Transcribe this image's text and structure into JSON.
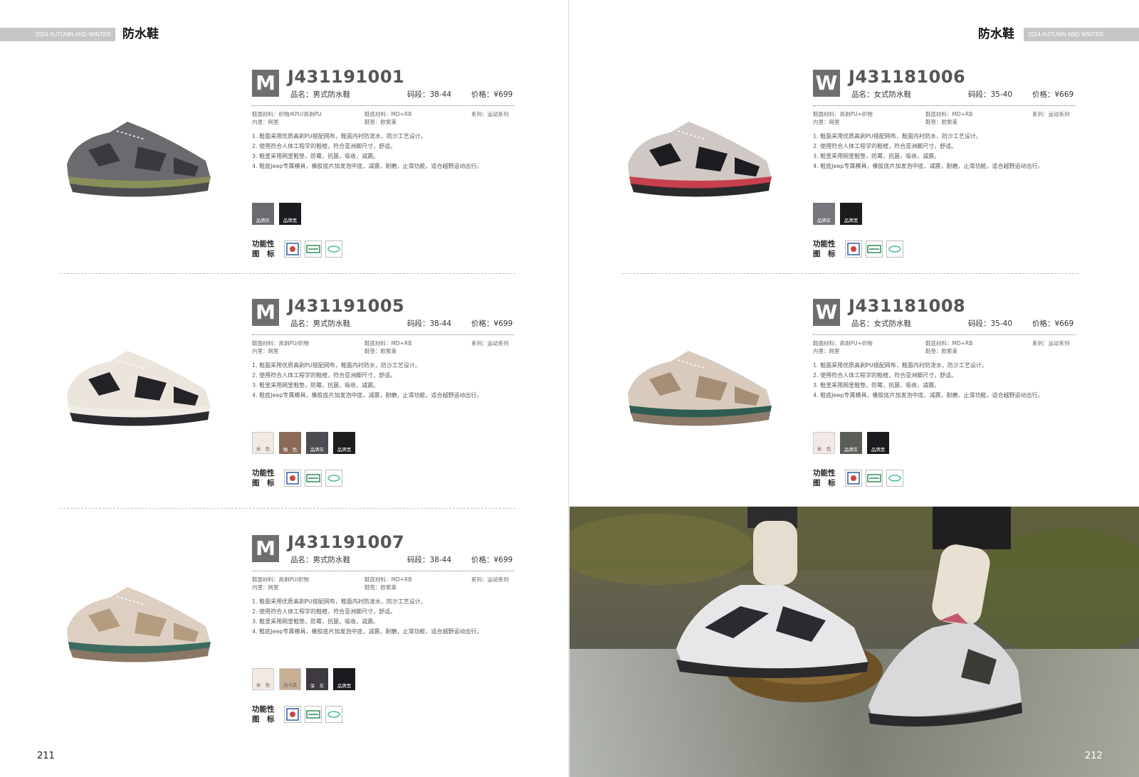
{
  "left_page": {
    "header_tag": "2024 AUTUMN AND WINTER",
    "category": "防水鞋",
    "page_number": "211",
    "products": [
      {
        "gender": "M",
        "code": "J431191001",
        "name": "品名：男式防水鞋",
        "size": "码段：38-44",
        "price": "价格：¥699",
        "upper": "鞋面材料：织物/KPU/高剥PU",
        "lining": "内里：网里",
        "sole": "鞋底材料：MD+RB",
        "insole": "鞋垫：欧索莱",
        "series": "系列：运动系列",
        "features": [
          "1. 鞋面采用优质高剥PU搭配网布，鞋面内衬防泼水，防沙工艺设计。",
          "2. 使用符合人体工程学的鞋楦，符合亚洲脚尺寸，舒适。",
          "3. 鞋里采用网里鞋垫，防霉，抗菌，吸收，减震。",
          "4. 鞋底Jeep专属模具，橡胶底片加发泡中底，减震，耐磨，止滑功能，适合越野运动出行。"
        ],
        "swatches": [
          {
            "label": "品牌灰",
            "color": "#6b6a6e"
          },
          {
            "label": "品牌黑",
            "color": "#1c1b1f"
          }
        ],
        "func_label": "功能性 图　标"
      },
      {
        "gender": "M",
        "code": "J431191005",
        "name": "品名：男式防水鞋",
        "size": "码段：38-44",
        "price": "价格：¥699",
        "upper": "鞋面材料：高剥PU/织物",
        "lining": "内里：网里",
        "sole": "鞋底材料：MD+RB",
        "insole": "鞋垫：欧索莱",
        "series": "系列：运动系列",
        "features": [
          "1. 鞋面采用优质高剥PU搭配网布，鞋面内衬防水，防沙工艺设计。",
          "2. 使用符合人体工程学的鞋楦，符合亚洲脚尺寸，舒适。",
          "3. 鞋里采用网里鞋垫，防霉，抗菌，吸收，减震。",
          "4. 鞋底Jeep专属模具，橡胶底片加发泡中底，减震，耐磨，止滑功能，适合越野运动出行。"
        ],
        "swatches": [
          {
            "label": "米　色",
            "color": "#f1e9e4"
          },
          {
            "label": "咖　色",
            "color": "#8c6a58"
          },
          {
            "label": "品牌灰",
            "color": "#4c4c55"
          },
          {
            "label": "品牌黑",
            "color": "#1d1c1f"
          }
        ],
        "func_label": "功能性 图　标"
      },
      {
        "gender": "M",
        "code": "J431191007",
        "name": "品名：男式防水鞋",
        "size": "码段：38-44",
        "price": "价格：¥699",
        "upper": "鞋面材料：高剥PU/织物",
        "lining": "内里：网里",
        "sole": "鞋底材料：MD+RB",
        "insole": "鞋垫：欧索莱",
        "series": "系列：运动系列",
        "features": [
          "1. 鞋面采用优质高剥PU搭配网布，鞋面内衬防泼水，防沙工艺设计。",
          "2. 使用符合人体工程学的鞋楦，符合亚洲脚尺寸，舒适。",
          "3. 鞋里采用网里鞋垫，防霉，抗菌，吸收，减震。",
          "4. 鞋底Jeep专属模具，橡胶底片加发泡中底，减震，耐磨，止滑功能，适合越野运动出行。"
        ],
        "swatches": [
          {
            "label": "米　色",
            "color": "#f3e9e3"
          },
          {
            "label": "浅卡其",
            "color": "#c7ae95"
          },
          {
            "label": "深　灰",
            "color": "#3e3a40"
          },
          {
            "label": "品牌黑",
            "color": "#1b1a1e"
          }
        ],
        "func_label": "功能性 图　标"
      }
    ]
  },
  "right_page": {
    "header_tag": "2024 AUTUMN AND WINTER",
    "category": "防水鞋",
    "page_number": "212",
    "products": [
      {
        "gender": "W",
        "code": "J431181006",
        "name": "品名：女式防水鞋",
        "size": "码段：35-40",
        "price": "价格：¥669",
        "upper": "鞋面材料：高剥PU+织物",
        "lining": "内里：网里",
        "sole": "鞋底材料：MD+RB",
        "insole": "鞋垫：欧索莱",
        "series": "系列：运动系列",
        "features": [
          "1. 鞋面采用优质高剥PU搭配网布，鞋面内衬防水，防沙工艺设计。",
          "2. 使用符合人体工程学的鞋楦，符合亚洲脚尺寸，舒适。",
          "3. 鞋里采用网里鞋垫，防霉，抗菌，吸收，减震。",
          "4. 鞋底Jeep专属模具，橡胶底片加发泡中底，减震，耐磨，止滑功能，适合越野运动出行。"
        ],
        "swatches": [
          {
            "label": "品牌灰",
            "color": "#77757b"
          },
          {
            "label": "品牌黑",
            "color": "#1b1a1d"
          }
        ],
        "func_label": "功能性 图　标"
      },
      {
        "gender": "W",
        "code": "J431181008",
        "name": "品名：女式防水鞋",
        "size": "码段：35-40",
        "price": "价格：¥669",
        "upper": "鞋面材料：高剥PU+织物",
        "lining": "内里：网里",
        "sole": "鞋底材料：MD+RB",
        "insole": "鞋垫：欧索莱",
        "series": "系列：运动系列",
        "features": [
          "1. 鞋面采用优质高剥PU搭配网布，鞋面内衬防泼水，防沙工艺设计。",
          "2. 使用符合人体工程学的鞋楦，符合亚洲脚尺寸，舒适。",
          "3. 鞋里采用网里鞋垫，防霉，抗菌，吸收，减震。",
          "4. 鞋底Jeep专属模具，橡胶底片加发泡中底，减震，耐磨，止滑功能，适合越野运动出行。"
        ],
        "swatches": [
          {
            "label": "米　色",
            "color": "#f3e8e5"
          },
          {
            "label": "品牌灰",
            "color": "#5b5e58"
          },
          {
            "label": "品牌黑",
            "color": "#1c1a1e"
          }
        ],
        "func_label": "功能性 图　标"
      }
    ]
  }
}
